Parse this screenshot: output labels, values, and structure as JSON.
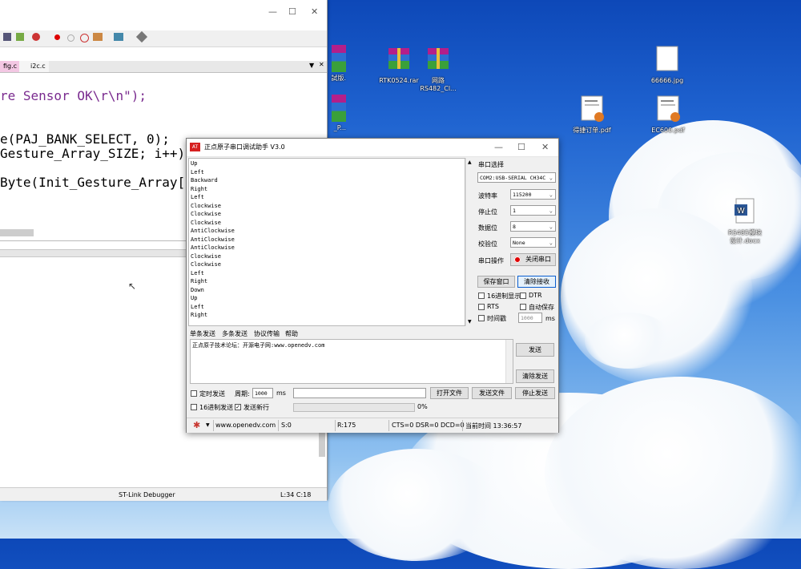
{
  "desktop": {
    "icons": [
      {
        "name": "rtk-rar-icon",
        "label": "RTK0524.rar"
      },
      {
        "name": "rs482-rar-icon",
        "label": "网路\nRS482_Cl..."
      },
      {
        "name": "jpg-file-icon",
        "label": "66666.jpg"
      },
      {
        "name": "pdf-file-icon-1",
        "label": "得捷订单.pdf"
      },
      {
        "name": "pdf-file-icon-2",
        "label": "EC600.pdf"
      },
      {
        "name": "word-file-icon",
        "label": "RS485模块\n设计.docx"
      }
    ],
    "partial_labels": [
      "試版.",
      "_P..."
    ]
  },
  "ide": {
    "tabs": [
      "fig.c",
      "i2c.c"
    ],
    "code_lines": [
      "re Sensor OK\\r\\n\");",
      "e(PAJ_BANK_SELECT, 0);",
      "Gesture_Array_SIZE; i++)",
      "Byte(Init_Gesture_Array[i]["
    ],
    "status": {
      "debugger": "ST-Link Debugger",
      "position": "L:34 C:18"
    }
  },
  "serial": {
    "title": "正点原子串口调试助手 V3.0",
    "received": [
      "Up",
      "Left",
      "Backward",
      "Right",
      "Left",
      "Clockwise",
      "Clockwise",
      "Clockwise",
      "AntiClockwise",
      "AntiClockwise",
      "AntiClockwise",
      "Clockwise",
      "Clockwise",
      "Left",
      "Right",
      "Down",
      "Up",
      "Left",
      "Right"
    ],
    "port_label": "串口选择",
    "port_value": "COM2:USB-SERIAL CH34C",
    "baud_label": "波特率",
    "baud_value": "115200",
    "stop_label": "停止位",
    "stop_value": "1",
    "data_label": "数据位",
    "data_value": "8",
    "parity_label": "校验位",
    "parity_value": "None",
    "op_label": "串口操作",
    "close_port": "关闭串口",
    "save_window": "保存窗口",
    "clear_recv": "清除接收",
    "hex_display": "16进制显示",
    "dtr": "DTR",
    "rts": "RTS",
    "auto_save": "自动保存",
    "timestamp": "时间戳",
    "timestamp_ms": "1000",
    "ms": "ms",
    "tabs": [
      "单条发送",
      "多条发送",
      "协议传输",
      "帮助"
    ],
    "send_text": "正点原子技术论坛：开源电子网:www.openedv.com",
    "send_btn": "发送",
    "clear_send": "清除发送",
    "timed_send": "定时发送",
    "period_label": "周期:",
    "period_value": "1000",
    "period_unit": "ms",
    "open_file": "打开文件",
    "send_file": "发送文件",
    "stop_send": "停止发送",
    "hex_send": "16进制发送",
    "send_newline": "发送新行",
    "progress": "0%",
    "footer": {
      "url": "www.openedv.com",
      "sent": "S:0",
      "recv": "R:175",
      "lines": "CTS=0 DSR=0 DCD=0",
      "time": "当前时间 13:36:57"
    }
  },
  "colors": {
    "accent": "#0c5fcf",
    "close_red": "#e00000"
  }
}
